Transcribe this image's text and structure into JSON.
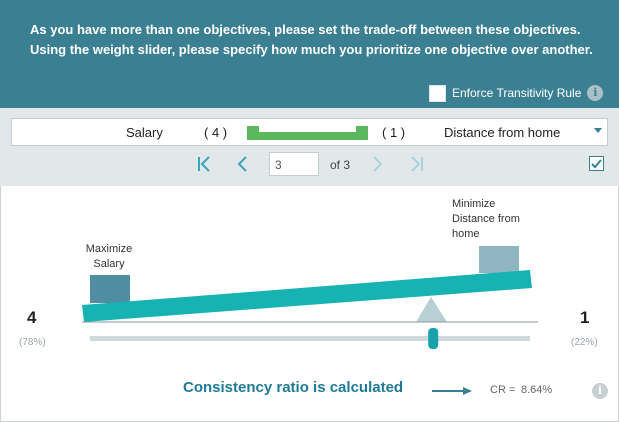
{
  "header": {
    "instructions": "As you have more than one objectives, please set the trade-off between these objectives. Using the weight slider, please specify how much you prioritize one objective over another.",
    "enforce_label": "Enforce Transitivity Rule",
    "enforce_checked": false
  },
  "selector": {
    "left_objective": "Salary",
    "left_weight": "( 4 )",
    "right_weight": "( 1 )",
    "right_objective": "Distance from home"
  },
  "navigation": {
    "page_value": "3",
    "page_of": "of 3",
    "checked": true
  },
  "balance": {
    "left_label": "Maximize Salary",
    "right_label": "Minimize Distance from home",
    "left_weight": "4",
    "right_weight": "1",
    "left_pct": "(78%)",
    "right_pct": "(22%)",
    "slider_fraction": 0.78
  },
  "footer": {
    "annotation": "Consistency ratio is calculated",
    "cr_label": "CR =",
    "cr_value": "8.64%"
  },
  "colors": {
    "header": "#3a7f92",
    "beam": "#17b3b3",
    "accent": "#3aa6b9",
    "bar_green": "#5cb85c"
  },
  "icons": [
    "info-icon",
    "first-page-icon",
    "previous-page-icon",
    "next-page-icon",
    "last-page-icon",
    "dropdown-caret-icon",
    "arrow-icon"
  ]
}
